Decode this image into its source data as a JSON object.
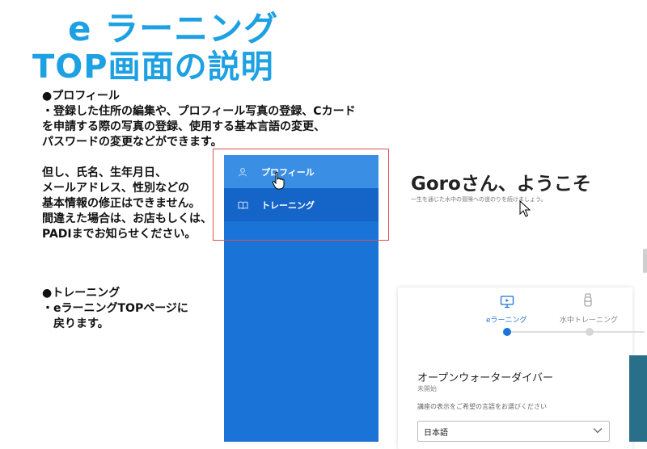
{
  "slide": {
    "title_line1": "e ラーニング",
    "title_line2": "TOP画面の説明",
    "title_color": "#1da1e2",
    "profile_notes": [
      "●プロフィール",
      "・登録した住所の編集や、プロフィール写真の登録、Cカード",
      "を申請する際の写真の登録、使用する基本言語の変更、",
      "パスワードの変更などができます。",
      "",
      "但し、氏名、生年月日、",
      "メールアドレス、性別などの",
      "基本情報の修正はできません。",
      "間違えた場合は、お店もしくは、",
      "PADIまでお知らせください。"
    ],
    "training_notes": [
      "●トレーニング",
      "・eラーニングTOPページに",
      "　戻ります。"
    ]
  },
  "sidebar": {
    "color": "#1a73d6",
    "items": [
      {
        "label": "プロフィール",
        "icon": "person-icon"
      },
      {
        "label": "トレーニング",
        "icon": "book-icon"
      }
    ]
  },
  "main": {
    "welcome": "Goroさん、ようこそ",
    "welcome_sub": "一生を通じた水中の冒険への道のりを続けましょう。",
    "steps": [
      {
        "label": "eラーニング",
        "icon": "monitor-icon",
        "active": true
      },
      {
        "label": "水中トレーニング",
        "icon": "diver-icon",
        "active": false
      }
    ],
    "course_title": "オープンウォーターダイバー",
    "course_status": "未開始",
    "language_prompt": "講座の表示をご希望の言語をお選びください",
    "language_value": "日本語"
  }
}
